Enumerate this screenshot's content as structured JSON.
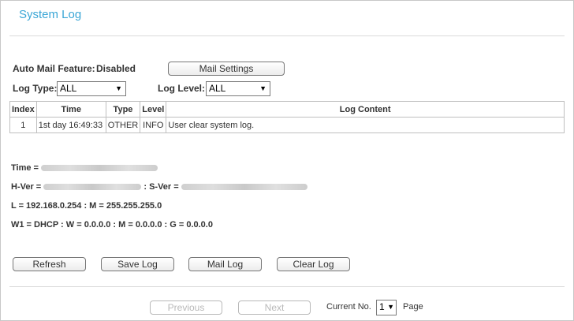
{
  "page": {
    "title": "System Log"
  },
  "mail": {
    "feature_label": "Auto Mail Feature:",
    "feature_value": "Disabled",
    "settings_button": "Mail Settings"
  },
  "filters": {
    "log_type_label": "Log Type:",
    "log_type_value": "ALL",
    "log_level_label": "Log Level:",
    "log_level_value": "ALL"
  },
  "table": {
    "headers": [
      "Index",
      "Time",
      "Type",
      "Level",
      "Log Content"
    ],
    "rows": [
      [
        "1",
        "1st day 16:49:33",
        "OTHER",
        "INFO",
        "User clear system log."
      ]
    ]
  },
  "info": {
    "time_label": "Time =",
    "hver_label": "H-Ver =",
    "sver_label": ": S-Ver =",
    "lan_line": "L = 192.168.0.254 : M = 255.255.255.0",
    "wan_line": "W1 = DHCP : W = 0.0.0.0 : M = 0.0.0.0 : G = 0.0.0.0"
  },
  "actions": {
    "refresh": "Refresh",
    "save_log": "Save Log",
    "mail_log": "Mail Log",
    "clear_log": "Clear Log"
  },
  "pager": {
    "previous": "Previous",
    "next": "Next",
    "current_label": "Current No.",
    "current_value": "1",
    "page_label": "Page"
  },
  "colors": {
    "title": "#3aa6d6",
    "border": "#bfbfbf"
  }
}
